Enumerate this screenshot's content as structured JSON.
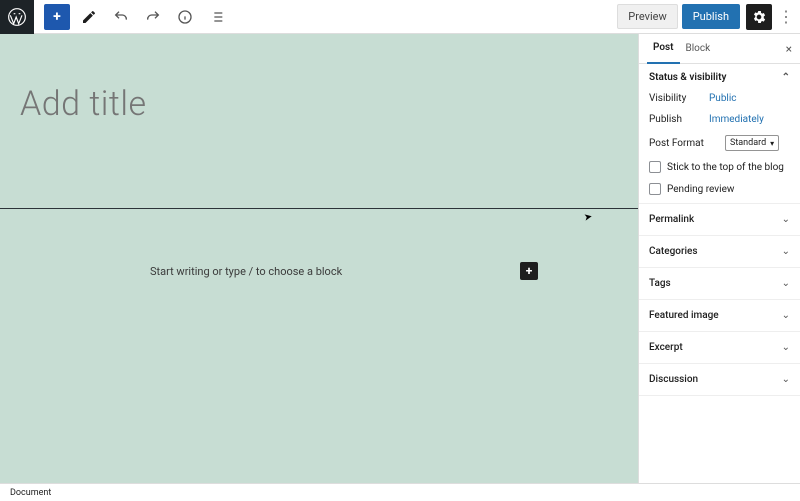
{
  "topbar": {
    "preview": "Preview",
    "publish": "Publish"
  },
  "canvas": {
    "title_placeholder": "Add title",
    "paragraph_placeholder": "Start writing or type / to choose a block"
  },
  "sidebar": {
    "tabs": {
      "post": "Post",
      "block": "Block",
      "close": "×"
    },
    "status_panel": {
      "title": "Status & visibility",
      "visibility_label": "Visibility",
      "visibility_value": "Public",
      "publish_label": "Publish",
      "publish_value": "Immediately",
      "format_label": "Post Format",
      "format_value": "Standard",
      "stick_label": "Stick to the top of the blog",
      "pending_label": "Pending review"
    },
    "accordions": [
      {
        "label": "Permalink"
      },
      {
        "label": "Categories"
      },
      {
        "label": "Tags"
      },
      {
        "label": "Featured image"
      },
      {
        "label": "Excerpt"
      },
      {
        "label": "Discussion"
      }
    ]
  },
  "footer": {
    "breadcrumb": "Document"
  }
}
